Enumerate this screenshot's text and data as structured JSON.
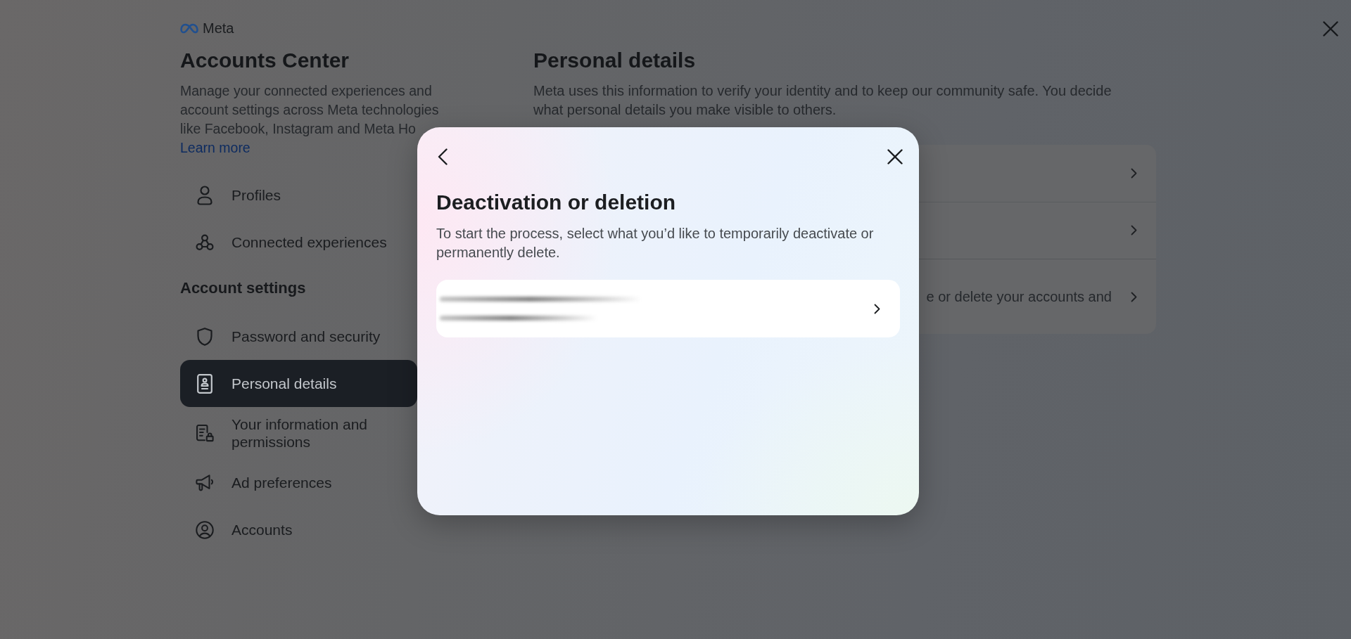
{
  "brand": {
    "name": "Meta"
  },
  "sidebar": {
    "title": "Accounts Center",
    "description": "Manage your connected experiences and account settings across Meta technologies like Facebook, Instagram and Meta Ho",
    "link": "Learn more",
    "groups": [
      {
        "items": [
          {
            "label": "Profiles",
            "selected": false
          },
          {
            "label": "Connected experiences",
            "selected": false
          }
        ]
      },
      {
        "heading": "Account settings",
        "items": [
          {
            "label": "Password and security",
            "selected": false
          },
          {
            "label": "Personal details",
            "selected": true
          },
          {
            "label": "Your information and permissions",
            "selected": false
          },
          {
            "label": "Ad preferences",
            "selected": false
          },
          {
            "label": "Accounts",
            "selected": false
          }
        ]
      }
    ]
  },
  "main": {
    "title": "Personal details",
    "description": "Meta uses this information to verify your identity and to keep our community safe. You decide what personal details you make visible to others.",
    "sections": [
      {
        "rows": [
          {
            "kind": "link"
          },
          {
            "kind": "link"
          }
        ]
      },
      {
        "rows": [
          {
            "kind": "link",
            "text": "e or delete your accounts and"
          }
        ]
      }
    ]
  },
  "dialog": {
    "title": "Deactivation or deletion",
    "description": "To start the process, select what you’d like to temporarily deactivate or permanently delete.",
    "options": [
      {
        "kind": "redacted"
      }
    ]
  }
}
